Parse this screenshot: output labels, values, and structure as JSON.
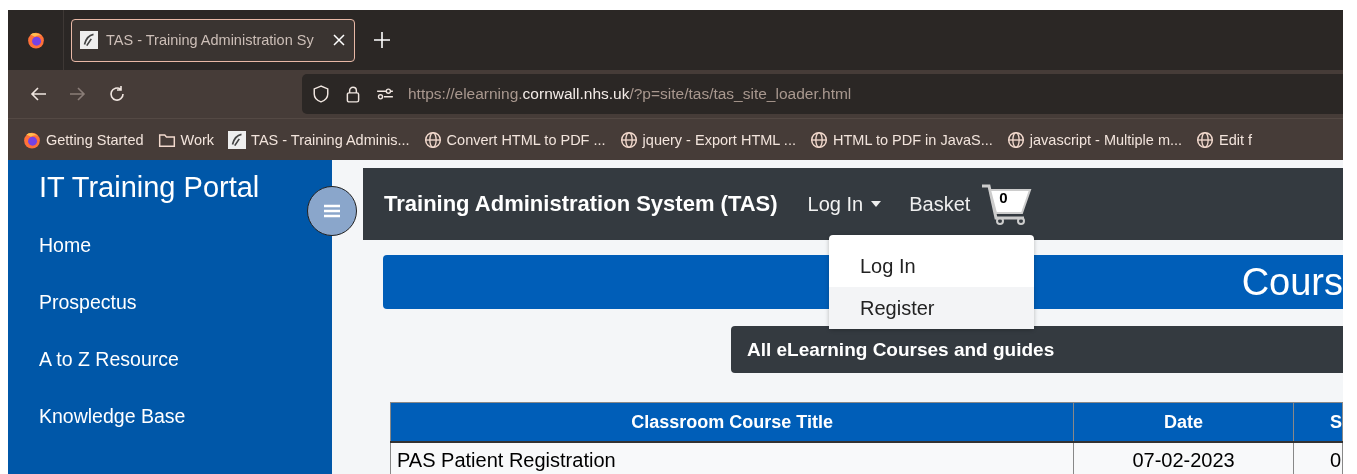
{
  "browser": {
    "tab": {
      "title": "TAS - Training Administration Sy",
      "selected": true
    },
    "url": {
      "before": "https://elearning.",
      "domain": "cornwall.nhs.uk",
      "after": "/?p=site/tas/tas_site_loader.html"
    },
    "bookmarks": [
      {
        "kind": "firefox",
        "label": "Getting Started"
      },
      {
        "kind": "folder",
        "label": "Work"
      },
      {
        "kind": "site",
        "label": "TAS - Training Adminis..."
      },
      {
        "kind": "globe",
        "label": "Convert HTML to PDF ..."
      },
      {
        "kind": "globe",
        "label": "jquery - Export HTML ..."
      },
      {
        "kind": "globe",
        "label": "HTML to PDF in JavaS..."
      },
      {
        "kind": "globe",
        "label": "javascript - Multiple m..."
      },
      {
        "kind": "globe",
        "label": "Edit f"
      }
    ]
  },
  "sidebar": {
    "title": "IT Training Portal",
    "items": [
      "Home",
      "Prospectus",
      "A to Z Resource",
      "Knowledge Base"
    ]
  },
  "header": {
    "title": "Training Administration System (TAS)",
    "login": {
      "label": "Log In",
      "expanded": true
    },
    "basket": {
      "label": "Basket",
      "count": "0"
    }
  },
  "dropdown": {
    "items": [
      {
        "label": "Log In",
        "highlighted": false
      },
      {
        "label": "Register",
        "highlighted": true
      }
    ]
  },
  "course_banner": "Cours",
  "section_title": "All eLearning Courses and guides",
  "table": {
    "columns": [
      "Classroom Course Title",
      "Date",
      "S"
    ],
    "rows": [
      [
        "PAS Patient Registration",
        "07-02-2023",
        "0"
      ]
    ]
  }
}
